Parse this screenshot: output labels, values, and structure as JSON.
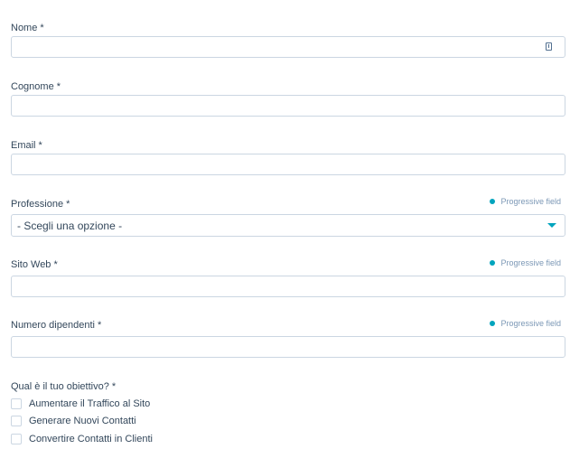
{
  "fields": {
    "nome": {
      "label": "Nome *",
      "value": ""
    },
    "cognome": {
      "label": "Cognome *",
      "value": ""
    },
    "email": {
      "label": "Email *",
      "value": ""
    },
    "professione": {
      "label": "Professione *",
      "selected": "- Scegli una opzione -",
      "progressive": "Progressive field"
    },
    "sito_web": {
      "label": "Sito Web *",
      "value": "",
      "progressive": "Progressive field"
    },
    "numero_dipendenti": {
      "label": "Numero dipendenti *",
      "value": "",
      "progressive": "Progressive field"
    }
  },
  "objective": {
    "label": "Qual è il tuo obiettivo? *",
    "options": [
      {
        "label": "Aumentare il Traffico al Sito",
        "checked": false
      },
      {
        "label": "Generare Nuovi Contatti",
        "checked": false
      },
      {
        "label": "Convertire Contatti in Clienti",
        "checked": false
      }
    ]
  },
  "icons": {
    "autofill": "contact-card-icon",
    "progressive_dot": "dot-icon",
    "dropdown": "caret-down-icon"
  },
  "colors": {
    "accent": "#00a4bd",
    "text": "#33475b",
    "border": "#cbd6e2",
    "muted": "#7c98b6"
  }
}
